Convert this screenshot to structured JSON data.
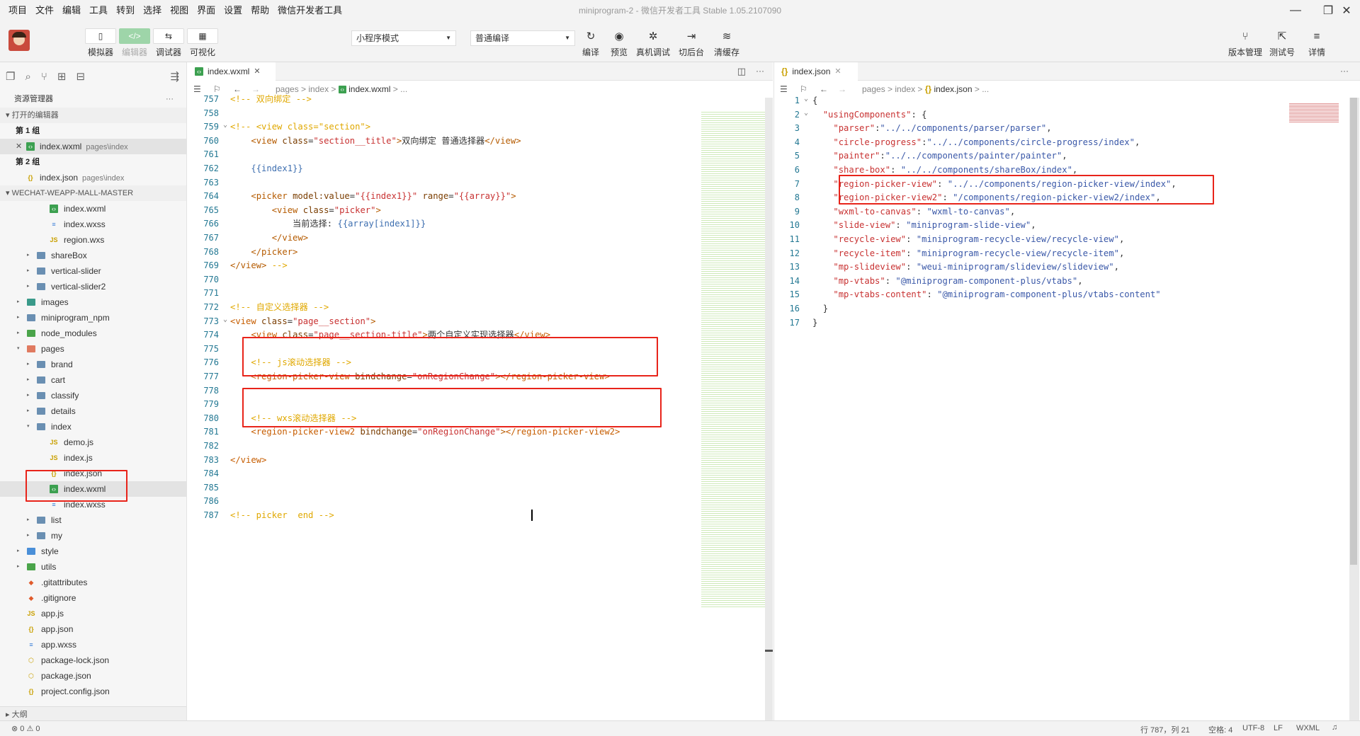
{
  "menu": [
    "项目",
    "文件",
    "编辑",
    "工具",
    "转到",
    "选择",
    "视图",
    "界面",
    "设置",
    "帮助",
    "微信开发者工具"
  ],
  "window_title": "miniprogram-2 - 微信开发者工具 Stable 1.05.2107090",
  "toolbar": {
    "left_buttons": [
      {
        "label": "模拟器",
        "icon": "phone-icon",
        "glyph": "▯"
      },
      {
        "label": "编辑器",
        "icon": "code-icon",
        "glyph": "</>"
      },
      {
        "label": "调试器",
        "icon": "debug-icon",
        "glyph": "⇆"
      },
      {
        "label": "可视化",
        "icon": "layout-icon",
        "glyph": "▦"
      }
    ],
    "mode_select": "小程序模式",
    "compile_select": "普通编译",
    "center_buttons": [
      {
        "label": "编译",
        "icon": "refresh-icon",
        "glyph": "↻"
      },
      {
        "label": "预览",
        "icon": "eye-icon",
        "glyph": "◉"
      },
      {
        "label": "真机调试",
        "icon": "bug-icon",
        "glyph": "✲"
      },
      {
        "label": "切后台",
        "icon": "switch-icon",
        "glyph": "⇥"
      },
      {
        "label": "清缓存",
        "icon": "layers-icon",
        "glyph": "≋"
      }
    ],
    "right_buttons": [
      {
        "label": "版本管理",
        "icon": "git-icon",
        "glyph": "⑂"
      },
      {
        "label": "测试号",
        "icon": "external-icon",
        "glyph": "⇱"
      },
      {
        "label": "详情",
        "icon": "menu-icon",
        "glyph": "≡"
      }
    ]
  },
  "sidebar": {
    "title": "资源管理器",
    "open_editors": "打开的编辑器",
    "group1": "第 1 组",
    "group2": "第 2 组",
    "open_files": [
      {
        "name": "index.wxml",
        "path": "pages\\index",
        "type": "wxml"
      },
      {
        "name": "index.json",
        "path": "pages\\index",
        "type": "json"
      }
    ],
    "project": "WECHAT-WEAPP-MALL-MASTER",
    "tree": [
      {
        "name": "index.wxml",
        "type": "wxml",
        "indent": 3
      },
      {
        "name": "index.wxss",
        "type": "wxss",
        "indent": 3
      },
      {
        "name": "region.wxs",
        "type": "js",
        "indent": 3
      },
      {
        "name": "shareBox",
        "type": "folder",
        "indent": 2,
        "arrow": "▸"
      },
      {
        "name": "vertical-slider",
        "type": "folder",
        "indent": 2,
        "arrow": "▸"
      },
      {
        "name": "vertical-slider2",
        "type": "folder",
        "indent": 2,
        "arrow": "▸"
      },
      {
        "name": "images",
        "type": "folder-img",
        "indent": 1,
        "arrow": "▸"
      },
      {
        "name": "miniprogram_npm",
        "type": "folder",
        "indent": 1,
        "arrow": "▸"
      },
      {
        "name": "node_modules",
        "type": "folder-ut",
        "indent": 1,
        "arrow": "▸"
      },
      {
        "name": "pages",
        "type": "folder-pg",
        "indent": 1,
        "arrow": "▾"
      },
      {
        "name": "brand",
        "type": "folder",
        "indent": 2,
        "arrow": "▸"
      },
      {
        "name": "cart",
        "type": "folder",
        "indent": 2,
        "arrow": "▸"
      },
      {
        "name": "classify",
        "type": "folder",
        "indent": 2,
        "arrow": "▸"
      },
      {
        "name": "details",
        "type": "folder",
        "indent": 2,
        "arrow": "▸"
      },
      {
        "name": "index",
        "type": "folder",
        "indent": 2,
        "arrow": "▾"
      },
      {
        "name": "demo.js",
        "type": "js",
        "indent": 3
      },
      {
        "name": "index.js",
        "type": "js",
        "indent": 3
      },
      {
        "name": "index.json",
        "type": "json",
        "indent": 3
      },
      {
        "name": "index.wxml",
        "type": "wxml",
        "indent": 3,
        "selected": true
      },
      {
        "name": "index.wxss",
        "type": "wxss",
        "indent": 3
      },
      {
        "name": "list",
        "type": "folder",
        "indent": 2,
        "arrow": "▸"
      },
      {
        "name": "my",
        "type": "folder",
        "indent": 2,
        "arrow": "▸"
      },
      {
        "name": "style",
        "type": "folder-st",
        "indent": 1,
        "arrow": "▸"
      },
      {
        "name": "utils",
        "type": "folder-ut",
        "indent": 1,
        "arrow": "▸"
      },
      {
        "name": ".gitattributes",
        "type": "git",
        "indent": 1
      },
      {
        "name": ".gitignore",
        "type": "git",
        "indent": 1
      },
      {
        "name": "app.js",
        "type": "js",
        "indent": 1
      },
      {
        "name": "app.json",
        "type": "json",
        "indent": 1
      },
      {
        "name": "app.wxss",
        "type": "wxss",
        "indent": 1
      },
      {
        "name": "package-lock.json",
        "type": "pkg",
        "indent": 1
      },
      {
        "name": "package.json",
        "type": "pkg",
        "indent": 1
      },
      {
        "name": "project.config.json",
        "type": "json",
        "indent": 1
      }
    ],
    "outline": "大纲"
  },
  "editor_left": {
    "tab": "index.wxml",
    "breadcrumb": [
      "pages",
      "index",
      "index.wxml",
      "..."
    ],
    "lines": [
      {
        "n": "757",
        "segs": [
          [
            "c-cm",
            "<!-- 双向绑定 -->"
          ]
        ]
      },
      {
        "n": "758",
        "segs": []
      },
      {
        "n": "759",
        "fold": true,
        "segs": [
          [
            "c-cm",
            "<!-- "
          ],
          [
            "c-cm",
            "<view class=\"section\">"
          ]
        ]
      },
      {
        "n": "760",
        "segs": [
          [
            "c-tx",
            "    "
          ],
          [
            "c-tg",
            "<view "
          ],
          [
            "c-at",
            "class"
          ],
          [
            "c-tx",
            "="
          ],
          [
            "c-st",
            "\"section__title\""
          ],
          [
            "c-tg",
            ">"
          ],
          [
            "c-tx",
            "双向绑定 普通选择器"
          ],
          [
            "c-tg",
            "</view>"
          ]
        ]
      },
      {
        "n": "761",
        "segs": []
      },
      {
        "n": "762",
        "segs": [
          [
            "c-tx",
            "    "
          ],
          [
            "c-bl",
            "{{index1}}"
          ]
        ]
      },
      {
        "n": "763",
        "segs": []
      },
      {
        "n": "764",
        "segs": [
          [
            "c-tx",
            "    "
          ],
          [
            "c-tg",
            "<picker "
          ],
          [
            "c-at",
            "model:value"
          ],
          [
            "c-tx",
            "="
          ],
          [
            "c-st",
            "\"{{index1}}\""
          ],
          [
            "c-tx",
            " "
          ],
          [
            "c-at",
            "range"
          ],
          [
            "c-tx",
            "="
          ],
          [
            "c-st",
            "\"{{array}}\""
          ],
          [
            "c-tg",
            ">"
          ]
        ]
      },
      {
        "n": "765",
        "segs": [
          [
            "c-tx",
            "        "
          ],
          [
            "c-tg",
            "<view "
          ],
          [
            "c-at",
            "class"
          ],
          [
            "c-tx",
            "="
          ],
          [
            "c-st",
            "\"picker\""
          ],
          [
            "c-tg",
            ">"
          ]
        ]
      },
      {
        "n": "766",
        "segs": [
          [
            "c-tx",
            "            当前选择: "
          ],
          [
            "c-bl",
            "{{array[index1]}}"
          ]
        ]
      },
      {
        "n": "767",
        "segs": [
          [
            "c-tx",
            "        "
          ],
          [
            "c-tg",
            "</view>"
          ]
        ]
      },
      {
        "n": "768",
        "segs": [
          [
            "c-tx",
            "    "
          ],
          [
            "c-tg",
            "</picker>"
          ]
        ]
      },
      {
        "n": "769",
        "segs": [
          [
            "c-tg",
            "</view>"
          ],
          [
            "c-cm",
            " -->"
          ]
        ]
      },
      {
        "n": "770",
        "segs": []
      },
      {
        "n": "771",
        "segs": []
      },
      {
        "n": "772",
        "segs": [
          [
            "c-cm",
            "<!-- 自定义选择器 -->"
          ]
        ]
      },
      {
        "n": "773",
        "fold": true,
        "segs": [
          [
            "c-tg2",
            "<view "
          ],
          [
            "c-at",
            "class"
          ],
          [
            "c-tx",
            "="
          ],
          [
            "c-st",
            "\"page__section\""
          ],
          [
            "c-tg",
            ">"
          ]
        ]
      },
      {
        "n": "774",
        "segs": [
          [
            "c-tx",
            "    "
          ],
          [
            "c-tg2",
            "<view "
          ],
          [
            "c-at",
            "class"
          ],
          [
            "c-tx",
            "="
          ],
          [
            "c-st",
            "\"page__section-title\""
          ],
          [
            "c-tg",
            ">"
          ],
          [
            "c-tx",
            "两个自定义实现选择器"
          ],
          [
            "c-tg2",
            "</view>"
          ]
        ]
      },
      {
        "n": "775",
        "segs": []
      },
      {
        "n": "776",
        "segs": [
          [
            "c-tx",
            "    "
          ],
          [
            "c-cm",
            "<!-- js滚动选择器 -->"
          ]
        ]
      },
      {
        "n": "777",
        "segs": [
          [
            "c-tx",
            "    "
          ],
          [
            "c-tg2",
            "<region-picker-view "
          ],
          [
            "c-at",
            "bindchange"
          ],
          [
            "c-tx",
            "="
          ],
          [
            "c-st",
            "\"onRegionChange\""
          ],
          [
            "c-tg",
            ">"
          ],
          [
            "c-tg2",
            "</region-picker-view>"
          ]
        ]
      },
      {
        "n": "778",
        "segs": []
      },
      {
        "n": "779",
        "segs": []
      },
      {
        "n": "780",
        "segs": [
          [
            "c-tx",
            "    "
          ],
          [
            "c-cm",
            "<!-- wxs滚动选择器 -->"
          ]
        ]
      },
      {
        "n": "781",
        "segs": [
          [
            "c-tx",
            "    "
          ],
          [
            "c-tg2",
            "<region-picker-view2 "
          ],
          [
            "c-at",
            "bindchange"
          ],
          [
            "c-tx",
            "="
          ],
          [
            "c-st",
            "\"onRegionChange\""
          ],
          [
            "c-tg",
            ">"
          ],
          [
            "c-tg2",
            "</region-picker-view2>"
          ]
        ]
      },
      {
        "n": "782",
        "segs": []
      },
      {
        "n": "783",
        "segs": [
          [
            "c-tg2",
            "</view>"
          ]
        ]
      },
      {
        "n": "784",
        "segs": []
      },
      {
        "n": "785",
        "segs": []
      },
      {
        "n": "786",
        "segs": []
      },
      {
        "n": "787",
        "segs": [
          [
            "c-cm",
            "<!-- picker  end -->"
          ]
        ]
      }
    ]
  },
  "editor_right": {
    "tab": "index.json",
    "breadcrumb": [
      "pages",
      "index",
      "index.json",
      "..."
    ],
    "lines": [
      {
        "n": "1",
        "fold": true,
        "segs": [
          [
            "c-pun",
            "{"
          ]
        ]
      },
      {
        "n": "2",
        "fold": true,
        "segs": [
          [
            "c-tx",
            "  "
          ],
          [
            "c-js-key",
            "\"usingComponents\""
          ],
          [
            "c-pun",
            ": {"
          ]
        ]
      },
      {
        "n": "3",
        "segs": [
          [
            "c-tx",
            "    "
          ],
          [
            "c-js-key",
            "\"parser\""
          ],
          [
            "c-pun",
            ":"
          ],
          [
            "c-js-val",
            "\"../../components/parser/parser\""
          ],
          [
            "c-pun",
            ","
          ]
        ]
      },
      {
        "n": "4",
        "segs": [
          [
            "c-tx",
            "    "
          ],
          [
            "c-js-key",
            "\"circle-progress\""
          ],
          [
            "c-pun",
            ":"
          ],
          [
            "c-js-val",
            "\"../../components/circle-progress/index\""
          ],
          [
            "c-pun",
            ","
          ]
        ]
      },
      {
        "n": "5",
        "segs": [
          [
            "c-tx",
            "    "
          ],
          [
            "c-js-key",
            "\"painter\""
          ],
          [
            "c-pun",
            ":"
          ],
          [
            "c-js-val",
            "\"../../components/painter/painter\""
          ],
          [
            "c-pun",
            ","
          ]
        ]
      },
      {
        "n": "6",
        "segs": [
          [
            "c-tx",
            "    "
          ],
          [
            "c-js-key",
            "\"share-box\""
          ],
          [
            "c-pun",
            ": "
          ],
          [
            "c-js-val",
            "\"../../components/shareBox/index\""
          ],
          [
            "c-pun",
            ","
          ]
        ]
      },
      {
        "n": "7",
        "segs": [
          [
            "c-tx",
            "    "
          ],
          [
            "c-js-key",
            "\"region-picker-view\""
          ],
          [
            "c-pun",
            ": "
          ],
          [
            "c-js-val",
            "\"../../components/region-picker-view/index\""
          ],
          [
            "c-pun",
            ","
          ]
        ]
      },
      {
        "n": "8",
        "segs": [
          [
            "c-tx",
            "    "
          ],
          [
            "c-js-key",
            "\"region-picker-view2\""
          ],
          [
            "c-pun",
            ": "
          ],
          [
            "c-js-val",
            "\"/components/region-picker-view2/index\""
          ],
          [
            "c-pun",
            ","
          ]
        ]
      },
      {
        "n": "9",
        "segs": [
          [
            "c-tx",
            "    "
          ],
          [
            "c-js-key",
            "\"wxml-to-canvas\""
          ],
          [
            "c-pun",
            ": "
          ],
          [
            "c-js-val",
            "\"wxml-to-canvas\""
          ],
          [
            "c-pun",
            ","
          ]
        ]
      },
      {
        "n": "10",
        "segs": [
          [
            "c-tx",
            "    "
          ],
          [
            "c-js-key",
            "\"slide-view\""
          ],
          [
            "c-pun",
            ": "
          ],
          [
            "c-js-val",
            "\"miniprogram-slide-view\""
          ],
          [
            "c-pun",
            ","
          ]
        ]
      },
      {
        "n": "11",
        "segs": [
          [
            "c-tx",
            "    "
          ],
          [
            "c-js-key",
            "\"recycle-view\""
          ],
          [
            "c-pun",
            ": "
          ],
          [
            "c-js-val",
            "\"miniprogram-recycle-view/recycle-view\""
          ],
          [
            "c-pun",
            ","
          ]
        ]
      },
      {
        "n": "12",
        "segs": [
          [
            "c-tx",
            "    "
          ],
          [
            "c-js-key",
            "\"recycle-item\""
          ],
          [
            "c-pun",
            ": "
          ],
          [
            "c-js-val",
            "\"miniprogram-recycle-view/recycle-item\""
          ],
          [
            "c-pun",
            ","
          ]
        ]
      },
      {
        "n": "13",
        "segs": [
          [
            "c-tx",
            "    "
          ],
          [
            "c-js-key",
            "\"mp-slideview\""
          ],
          [
            "c-pun",
            ": "
          ],
          [
            "c-js-val",
            "\"weui-miniprogram/slideview/slideview\""
          ],
          [
            "c-pun",
            ","
          ]
        ]
      },
      {
        "n": "14",
        "segs": [
          [
            "c-tx",
            "    "
          ],
          [
            "c-js-key",
            "\"mp-vtabs\""
          ],
          [
            "c-pun",
            ": "
          ],
          [
            "c-js-val",
            "\"@miniprogram-component-plus/vtabs\""
          ],
          [
            "c-pun",
            ","
          ]
        ]
      },
      {
        "n": "15",
        "segs": [
          [
            "c-tx",
            "    "
          ],
          [
            "c-js-key",
            "\"mp-vtabs-content\""
          ],
          [
            "c-pun",
            ": "
          ],
          [
            "c-js-val",
            "\"@miniprogram-component-plus/vtabs-content\""
          ]
        ]
      },
      {
        "n": "16",
        "segs": [
          [
            "c-tx",
            "  "
          ],
          [
            "c-pun",
            "}"
          ]
        ]
      },
      {
        "n": "17",
        "segs": [
          [
            "c-pun",
            "}"
          ]
        ]
      }
    ]
  },
  "statusbar": {
    "problems": "⊗ 0 ⚠ 0",
    "position": "行 787，列 21",
    "spaces": "空格: 4",
    "encoding": "UTF-8",
    "eol": "LF",
    "language": "WXML"
  }
}
